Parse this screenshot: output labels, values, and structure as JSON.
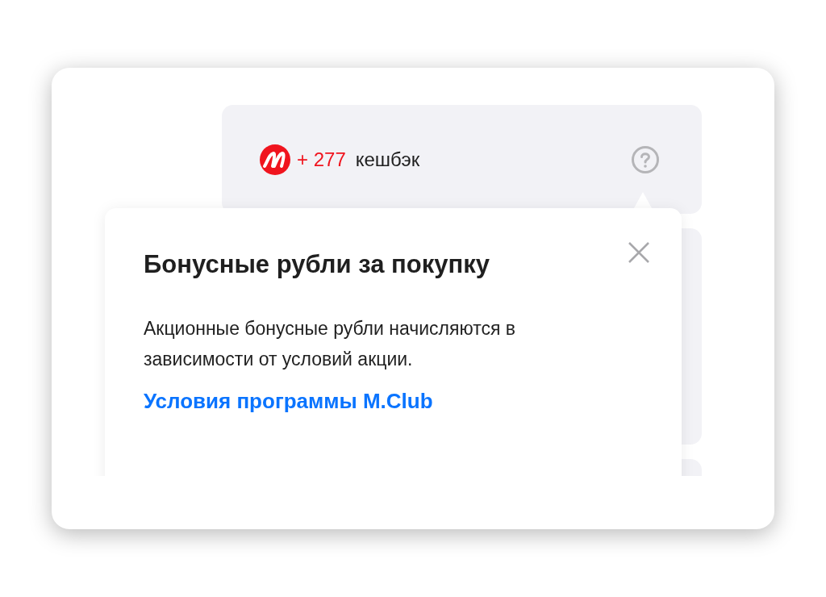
{
  "cashback": {
    "amount": "+ 277",
    "label": "кешбэк"
  },
  "popover": {
    "title": "Бонусные рубли за покупку",
    "text": "Акционные бонусные рубли начисляются в зависимости от условий акции.",
    "link": "Условия программы M.Club"
  }
}
